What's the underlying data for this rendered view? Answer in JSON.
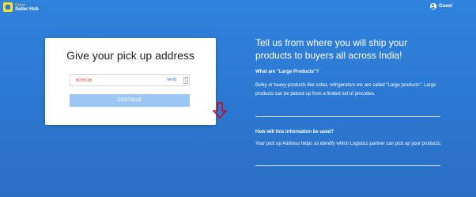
{
  "header": {
    "logo_small": "Flipkart",
    "logo_big": "Seller Hub",
    "user_label": "Guest",
    "logo_color": "#ffe11b"
  },
  "card": {
    "title": "Give your pick up address",
    "pincode_value": "600016",
    "verify_label": "Verify",
    "continue_label": "CONTINUE"
  },
  "info": {
    "headline": "Tell us from where you will ship your products to buyers all across India!",
    "q1": "What are \"Large Products\"?",
    "a1": "Bulky or heavy products like sofas, refrigerators etc are called \"Large products\". Large products can be picked up from a limited set of pincodes.",
    "q2": "How will this information be used?",
    "a2": "Your pick up Address helps us identify which Logistics partner can pick up your products."
  },
  "colors": {
    "background": "#2f82dd",
    "continue_button": "#9cc7f5",
    "pincode_text": "#ff3b30",
    "link": "#2874f0",
    "annotation_arrow": "#d0021b"
  }
}
